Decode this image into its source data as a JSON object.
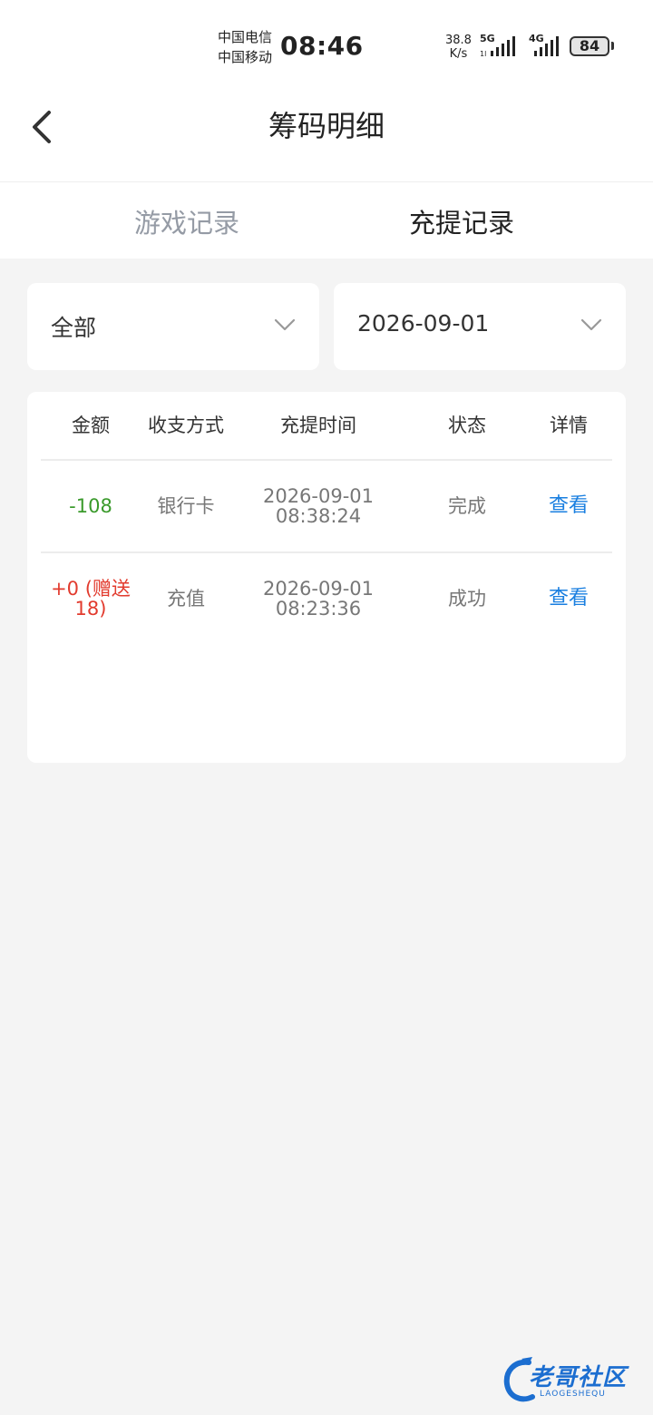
{
  "status_bar": {
    "carrier_1": "中国电信",
    "carrier_2": "中国移动",
    "time": "08:46",
    "net_speed_value": "38.8",
    "net_speed_unit": "K/s",
    "signal_1_label": "5G",
    "signal_2_label": "4G",
    "battery": "84"
  },
  "header": {
    "title": "筹码明细",
    "back_icon": "chevron-left-icon"
  },
  "tabs": [
    {
      "label": "游戏记录",
      "active": false
    },
    {
      "label": "充提记录",
      "active": true
    }
  ],
  "filters": {
    "type_value": "全部",
    "date_value": "2026-09-01"
  },
  "table": {
    "headers": [
      "金额",
      "收支方式",
      "充提时间",
      "状态",
      "详情"
    ],
    "rows": [
      {
        "amount": "-108",
        "method": "银行卡",
        "date": "2026-09-01",
        "time": "08:38:24",
        "status": "完成",
        "action": "查看"
      },
      {
        "amount": "+0 (赠送18)",
        "method": "充值",
        "date": "2026-09-01",
        "time": "08:23:36",
        "status": "成功",
        "action": "查看"
      }
    ]
  },
  "watermark": {
    "text": "老哥社区",
    "sub": "LAOGESHEQU"
  },
  "colors": {
    "negative_amount": "#3a9a2b",
    "positive_amount": "#e23b2e",
    "link": "#1a7fe0",
    "inactive_tab": "#959ba5",
    "background": "#f4f4f4"
  }
}
